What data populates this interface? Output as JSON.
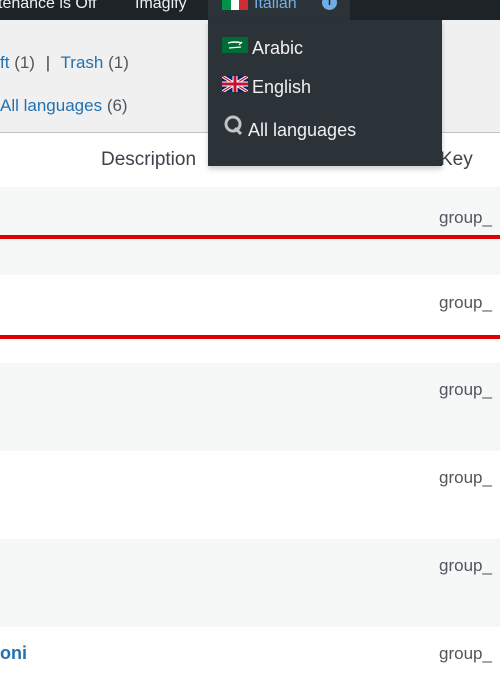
{
  "admin_bar": {
    "maintenance": "tenance is Off",
    "imagify": "Imagify",
    "language_label": "Italian",
    "info_icon": "info-icon"
  },
  "language_menu": {
    "items": [
      {
        "label": "Arabic",
        "flag": "flag-saudi-arabia"
      },
      {
        "label": "English",
        "flag": "flag-uk"
      },
      {
        "label": "All languages",
        "icon": "translate-icon"
      }
    ]
  },
  "views": {
    "draft_label": "ft",
    "draft_count": "(1)",
    "separator": "|",
    "trash_label": "Trash",
    "trash_count": "(1)",
    "all_languages_label": "All languages",
    "all_languages_count": "(6)"
  },
  "table": {
    "columns": [
      "Description",
      "Key"
    ],
    "rows": [
      {
        "key": "group_"
      },
      {
        "key": "group_"
      },
      {
        "key": "group_"
      },
      {
        "key": "group_"
      },
      {
        "key": "group_"
      },
      {
        "key": "group_",
        "title": "oni"
      }
    ]
  },
  "colors": {
    "admin_bar": "#1d2327",
    "link": "#2271b1",
    "highlight": "#e00000"
  }
}
